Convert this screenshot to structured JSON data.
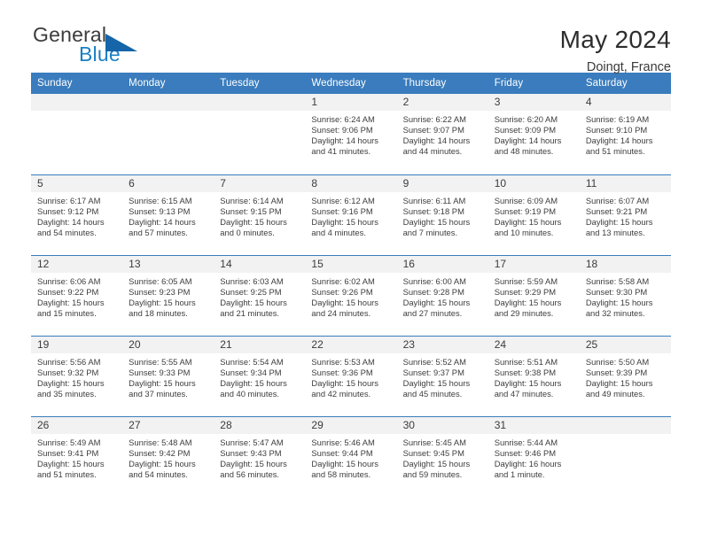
{
  "brand": {
    "name_top": "General",
    "name_bottom": "Blue",
    "triangle_icon": "triangle-icon",
    "color_dark": "#3c3c3c",
    "color_blue": "#1b7fc4"
  },
  "header": {
    "title": "May 2024",
    "subtitle": "Doingt, France"
  },
  "theme": {
    "header_bg": "#3a7cbd",
    "header_text": "#ffffff",
    "daynum_bg": "#f2f2f2",
    "divider": "#3a7cbd"
  },
  "weekdays": [
    "Sunday",
    "Monday",
    "Tuesday",
    "Wednesday",
    "Thursday",
    "Friday",
    "Saturday"
  ],
  "labels": {
    "sunrise": "Sunrise:",
    "sunset": "Sunset:",
    "daylight": "Daylight:"
  },
  "weeks": [
    [
      {
        "day": "",
        "empty": true
      },
      {
        "day": "",
        "empty": true
      },
      {
        "day": "",
        "empty": true
      },
      {
        "day": "1",
        "sunrise": "Sunrise: 6:24 AM",
        "sunset": "Sunset: 9:06 PM",
        "daylight_1": "Daylight: 14 hours",
        "daylight_2": "and 41 minutes."
      },
      {
        "day": "2",
        "sunrise": "Sunrise: 6:22 AM",
        "sunset": "Sunset: 9:07 PM",
        "daylight_1": "Daylight: 14 hours",
        "daylight_2": "and 44 minutes."
      },
      {
        "day": "3",
        "sunrise": "Sunrise: 6:20 AM",
        "sunset": "Sunset: 9:09 PM",
        "daylight_1": "Daylight: 14 hours",
        "daylight_2": "and 48 minutes."
      },
      {
        "day": "4",
        "sunrise": "Sunrise: 6:19 AM",
        "sunset": "Sunset: 9:10 PM",
        "daylight_1": "Daylight: 14 hours",
        "daylight_2": "and 51 minutes."
      }
    ],
    [
      {
        "day": "5",
        "sunrise": "Sunrise: 6:17 AM",
        "sunset": "Sunset: 9:12 PM",
        "daylight_1": "Daylight: 14 hours",
        "daylight_2": "and 54 minutes."
      },
      {
        "day": "6",
        "sunrise": "Sunrise: 6:15 AM",
        "sunset": "Sunset: 9:13 PM",
        "daylight_1": "Daylight: 14 hours",
        "daylight_2": "and 57 minutes."
      },
      {
        "day": "7",
        "sunrise": "Sunrise: 6:14 AM",
        "sunset": "Sunset: 9:15 PM",
        "daylight_1": "Daylight: 15 hours",
        "daylight_2": "and 0 minutes."
      },
      {
        "day": "8",
        "sunrise": "Sunrise: 6:12 AM",
        "sunset": "Sunset: 9:16 PM",
        "daylight_1": "Daylight: 15 hours",
        "daylight_2": "and 4 minutes."
      },
      {
        "day": "9",
        "sunrise": "Sunrise: 6:11 AM",
        "sunset": "Sunset: 9:18 PM",
        "daylight_1": "Daylight: 15 hours",
        "daylight_2": "and 7 minutes."
      },
      {
        "day": "10",
        "sunrise": "Sunrise: 6:09 AM",
        "sunset": "Sunset: 9:19 PM",
        "daylight_1": "Daylight: 15 hours",
        "daylight_2": "and 10 minutes."
      },
      {
        "day": "11",
        "sunrise": "Sunrise: 6:07 AM",
        "sunset": "Sunset: 9:21 PM",
        "daylight_1": "Daylight: 15 hours",
        "daylight_2": "and 13 minutes."
      }
    ],
    [
      {
        "day": "12",
        "sunrise": "Sunrise: 6:06 AM",
        "sunset": "Sunset: 9:22 PM",
        "daylight_1": "Daylight: 15 hours",
        "daylight_2": "and 15 minutes."
      },
      {
        "day": "13",
        "sunrise": "Sunrise: 6:05 AM",
        "sunset": "Sunset: 9:23 PM",
        "daylight_1": "Daylight: 15 hours",
        "daylight_2": "and 18 minutes."
      },
      {
        "day": "14",
        "sunrise": "Sunrise: 6:03 AM",
        "sunset": "Sunset: 9:25 PM",
        "daylight_1": "Daylight: 15 hours",
        "daylight_2": "and 21 minutes."
      },
      {
        "day": "15",
        "sunrise": "Sunrise: 6:02 AM",
        "sunset": "Sunset: 9:26 PM",
        "daylight_1": "Daylight: 15 hours",
        "daylight_2": "and 24 minutes."
      },
      {
        "day": "16",
        "sunrise": "Sunrise: 6:00 AM",
        "sunset": "Sunset: 9:28 PM",
        "daylight_1": "Daylight: 15 hours",
        "daylight_2": "and 27 minutes."
      },
      {
        "day": "17",
        "sunrise": "Sunrise: 5:59 AM",
        "sunset": "Sunset: 9:29 PM",
        "daylight_1": "Daylight: 15 hours",
        "daylight_2": "and 29 minutes."
      },
      {
        "day": "18",
        "sunrise": "Sunrise: 5:58 AM",
        "sunset": "Sunset: 9:30 PM",
        "daylight_1": "Daylight: 15 hours",
        "daylight_2": "and 32 minutes."
      }
    ],
    [
      {
        "day": "19",
        "sunrise": "Sunrise: 5:56 AM",
        "sunset": "Sunset: 9:32 PM",
        "daylight_1": "Daylight: 15 hours",
        "daylight_2": "and 35 minutes."
      },
      {
        "day": "20",
        "sunrise": "Sunrise: 5:55 AM",
        "sunset": "Sunset: 9:33 PM",
        "daylight_1": "Daylight: 15 hours",
        "daylight_2": "and 37 minutes."
      },
      {
        "day": "21",
        "sunrise": "Sunrise: 5:54 AM",
        "sunset": "Sunset: 9:34 PM",
        "daylight_1": "Daylight: 15 hours",
        "daylight_2": "and 40 minutes."
      },
      {
        "day": "22",
        "sunrise": "Sunrise: 5:53 AM",
        "sunset": "Sunset: 9:36 PM",
        "daylight_1": "Daylight: 15 hours",
        "daylight_2": "and 42 minutes."
      },
      {
        "day": "23",
        "sunrise": "Sunrise: 5:52 AM",
        "sunset": "Sunset: 9:37 PM",
        "daylight_1": "Daylight: 15 hours",
        "daylight_2": "and 45 minutes."
      },
      {
        "day": "24",
        "sunrise": "Sunrise: 5:51 AM",
        "sunset": "Sunset: 9:38 PM",
        "daylight_1": "Daylight: 15 hours",
        "daylight_2": "and 47 minutes."
      },
      {
        "day": "25",
        "sunrise": "Sunrise: 5:50 AM",
        "sunset": "Sunset: 9:39 PM",
        "daylight_1": "Daylight: 15 hours",
        "daylight_2": "and 49 minutes."
      }
    ],
    [
      {
        "day": "26",
        "sunrise": "Sunrise: 5:49 AM",
        "sunset": "Sunset: 9:41 PM",
        "daylight_1": "Daylight: 15 hours",
        "daylight_2": "and 51 minutes."
      },
      {
        "day": "27",
        "sunrise": "Sunrise: 5:48 AM",
        "sunset": "Sunset: 9:42 PM",
        "daylight_1": "Daylight: 15 hours",
        "daylight_2": "and 54 minutes."
      },
      {
        "day": "28",
        "sunrise": "Sunrise: 5:47 AM",
        "sunset": "Sunset: 9:43 PM",
        "daylight_1": "Daylight: 15 hours",
        "daylight_2": "and 56 minutes."
      },
      {
        "day": "29",
        "sunrise": "Sunrise: 5:46 AM",
        "sunset": "Sunset: 9:44 PM",
        "daylight_1": "Daylight: 15 hours",
        "daylight_2": "and 58 minutes."
      },
      {
        "day": "30",
        "sunrise": "Sunrise: 5:45 AM",
        "sunset": "Sunset: 9:45 PM",
        "daylight_1": "Daylight: 15 hours",
        "daylight_2": "and 59 minutes."
      },
      {
        "day": "31",
        "sunrise": "Sunrise: 5:44 AM",
        "sunset": "Sunset: 9:46 PM",
        "daylight_1": "Daylight: 16 hours",
        "daylight_2": "and 1 minute."
      },
      {
        "day": "",
        "empty": true
      }
    ]
  ]
}
